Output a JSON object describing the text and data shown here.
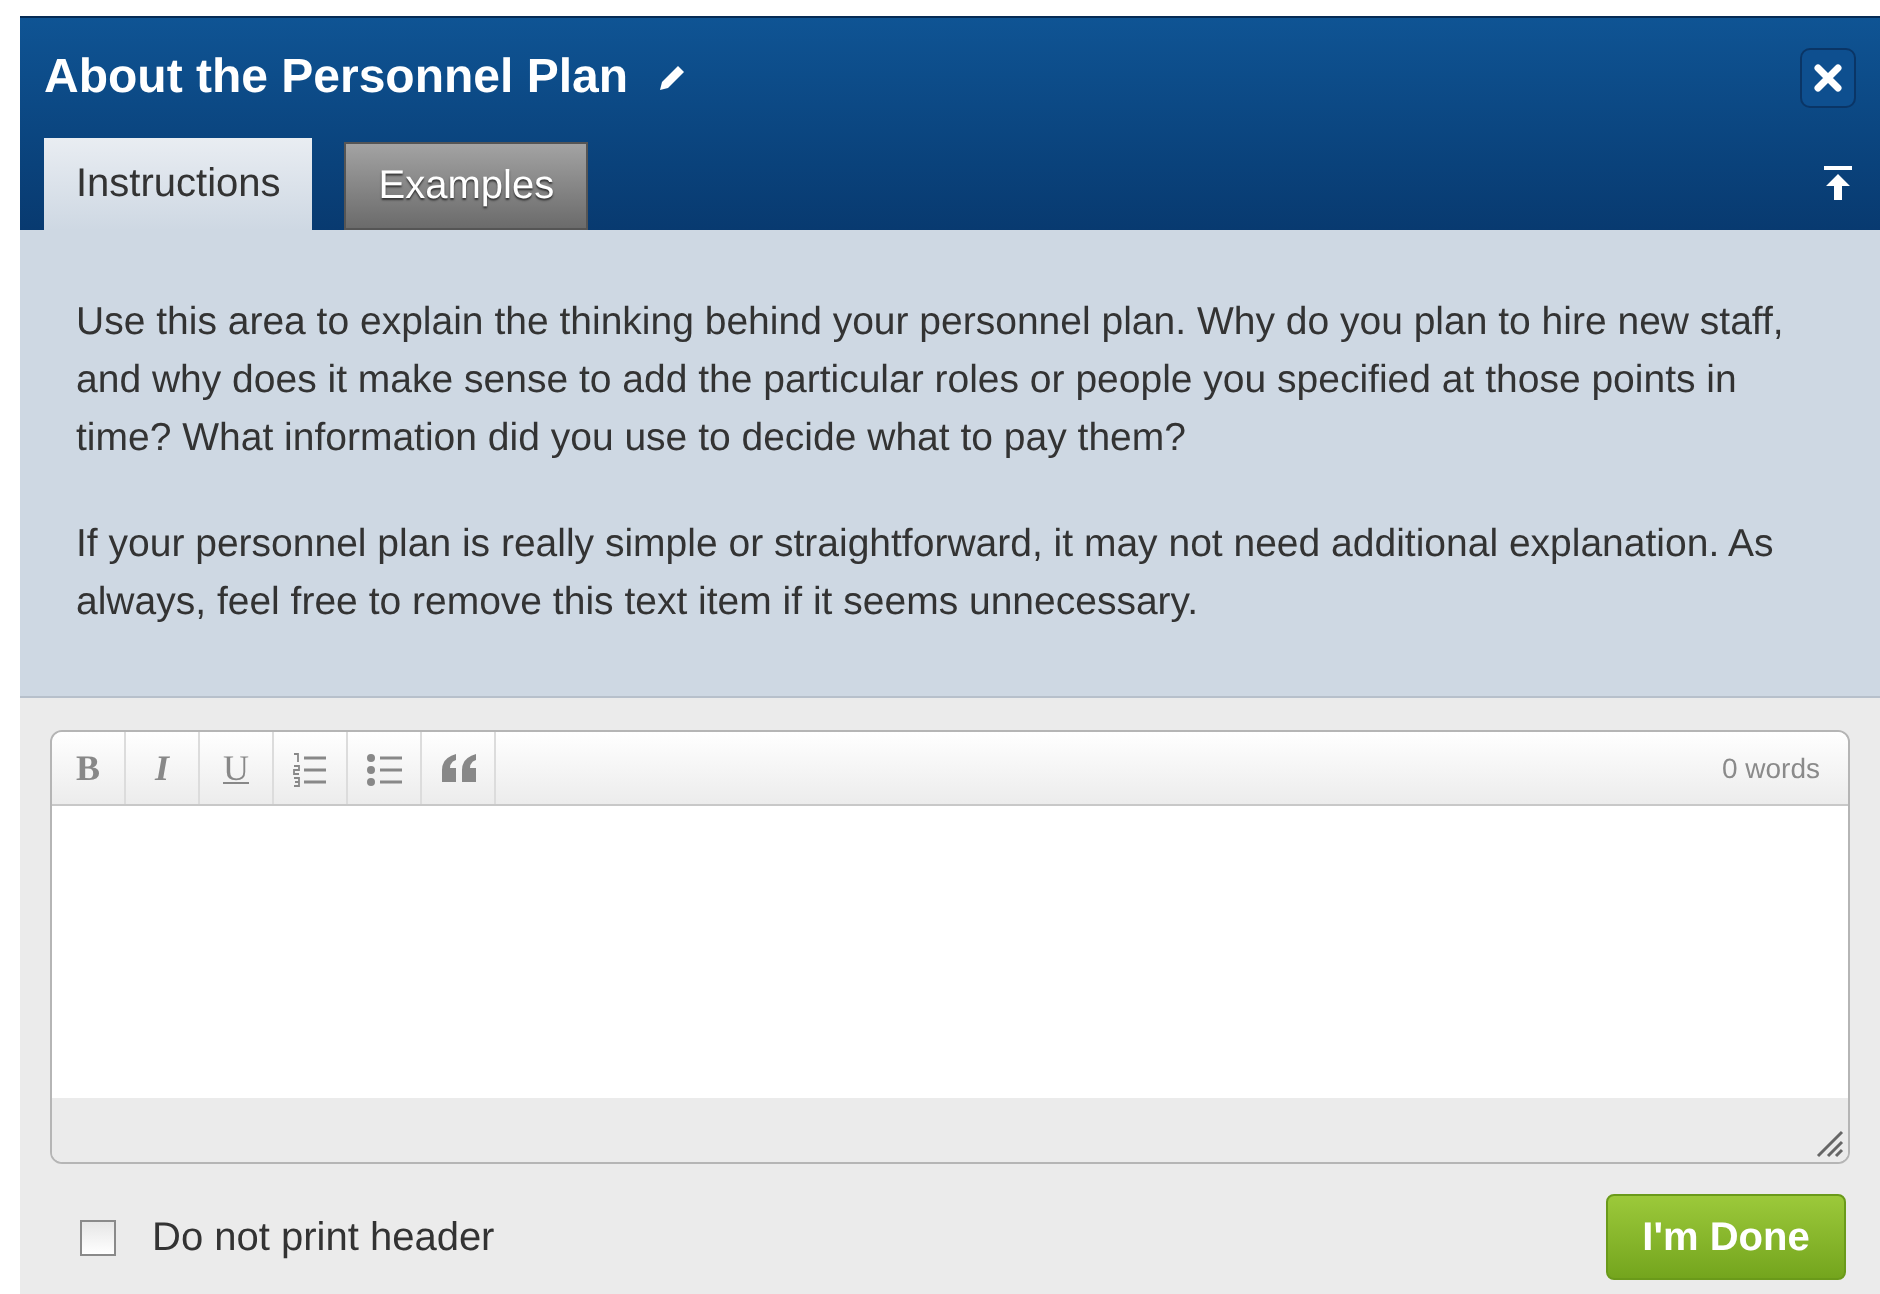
{
  "dialog": {
    "title": "About the Personnel Plan"
  },
  "tabs": [
    {
      "label": "Instructions",
      "selected": true
    },
    {
      "label": "Examples",
      "selected": false
    }
  ],
  "instructions": [
    "Use this area to explain the thinking behind your personnel plan. Why do you plan to hire new staff, and why does it make sense to add the particular roles or people you specified at those points in time? What information did you use to decide what to pay them?",
    "If your personnel plan is really simple or straightforward, it may not need additional explanation. As always, feel free to remove this text item if it seems unnecessary."
  ],
  "editor": {
    "toolbar": [
      {
        "kind": "bold",
        "label": "B"
      },
      {
        "kind": "italic",
        "label": "I"
      },
      {
        "kind": "underline",
        "label": "U"
      },
      {
        "kind": "ordered_list"
      },
      {
        "kind": "bullet_list"
      },
      {
        "kind": "quote"
      }
    ],
    "word_count": "0 words"
  },
  "print_header": {
    "label": "Do not print header",
    "checked": false
  },
  "done_button": "I'm Done"
}
